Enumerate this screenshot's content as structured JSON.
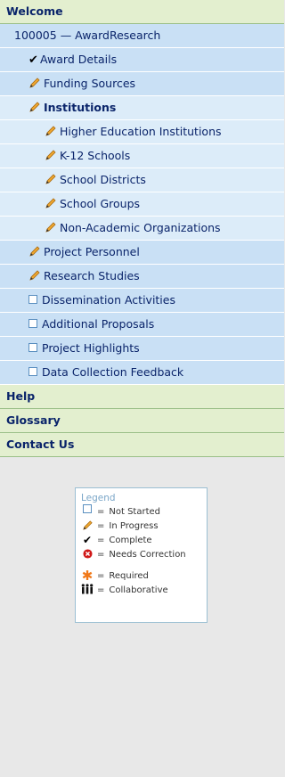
{
  "sections": {
    "welcome": "Welcome",
    "help": "Help",
    "glossary": "Glossary",
    "contact": "Contact Us"
  },
  "award": {
    "label": "100005 — AwardResearch"
  },
  "items": [
    {
      "label": "Award Details",
      "status": "complete"
    },
    {
      "label": "Funding Sources",
      "status": "in-progress"
    },
    {
      "label": "Institutions",
      "status": "in-progress",
      "selected": true
    },
    {
      "label": "Higher Education Institutions",
      "status": "in-progress"
    },
    {
      "label": "K-12 Schools",
      "status": "in-progress"
    },
    {
      "label": "School Districts",
      "status": "in-progress"
    },
    {
      "label": "School Groups",
      "status": "in-progress"
    },
    {
      "label": "Non-Academic Organizations",
      "status": "in-progress"
    },
    {
      "label": "Project Personnel",
      "status": "in-progress"
    },
    {
      "label": "Research Studies",
      "status": "in-progress"
    },
    {
      "label": "Dissemination Activities",
      "status": "not-started"
    },
    {
      "label": "Additional Proposals",
      "status": "not-started"
    },
    {
      "label": "Project Highlights",
      "status": "not-started"
    },
    {
      "label": "Data Collection Feedback",
      "status": "not-started"
    }
  ],
  "legend": {
    "title": "Legend",
    "eq": "=",
    "entries": [
      {
        "icon": "checkbox-icon",
        "label": "Not Started"
      },
      {
        "icon": "pencil-icon",
        "label": "In Progress"
      },
      {
        "icon": "checkmark-icon",
        "label": "Complete"
      },
      {
        "icon": "error-icon",
        "label": "Needs Correction"
      },
      {
        "icon": "asterisk-icon",
        "label": "Required"
      },
      {
        "icon": "people-icon",
        "label": "Collaborative"
      }
    ]
  },
  "colors": {
    "section_bg": "#e3efcf",
    "nav_bg": "#c9e0f5",
    "nav_sub_bg": "#dcecf9",
    "text": "#0a246a",
    "page_bg": "#e8e8e8"
  }
}
